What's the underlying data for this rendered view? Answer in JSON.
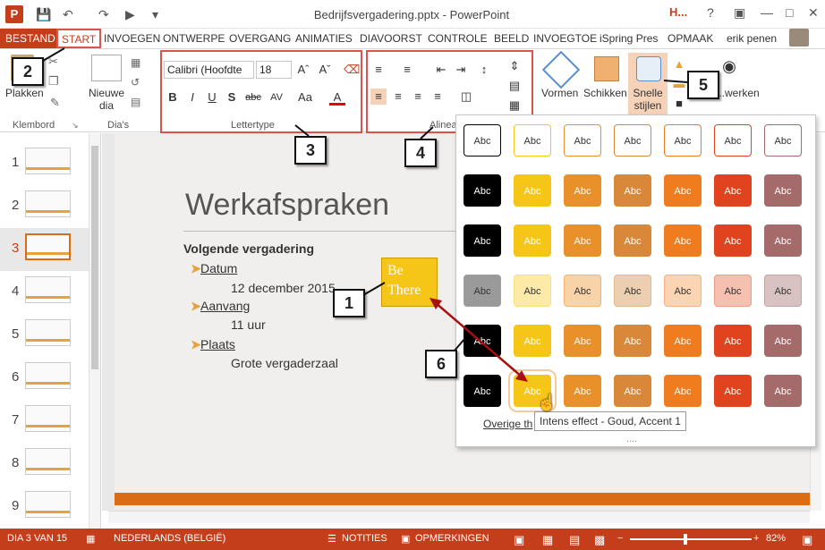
{
  "window": {
    "title": "Bedrijfsvergadering.pptx - PowerPoint",
    "user": "erik penen",
    "help": "?",
    "ppt_badge": "P"
  },
  "tabs": {
    "file": "BESTAND",
    "start": "START",
    "insert": "INVOEGEN",
    "design": "ONTWERPE",
    "transitions": "OVERGANG",
    "animations": "ANIMATIES",
    "slideshow": "DIAVOORST",
    "review": "CONTROLE",
    "view": "BEELD",
    "insert2": "INVOEGTOE",
    "ispring": "iSpring Pres",
    "format": "OPMAAK",
    "h": "H..."
  },
  "ribbon": {
    "paste": "Plakken",
    "new_slide": "Nieuwe dia",
    "clipboard_group": "Klembord",
    "slides_group": "Dia's",
    "font_name": "Calibri (Hoofdte",
    "font_size": "18",
    "font_group": "Lettertype",
    "paragraph_group": "Alinea",
    "shapes": "Vormen",
    "arrange": "Schikken",
    "quick_styles": "Snelle stijlen",
    "edit": "...werken",
    "bold": "B",
    "italic": "I",
    "underline": "U",
    "shadow": "S",
    "strike": "abc",
    "spacing": "AV",
    "case": "Aa",
    "font_color": "A"
  },
  "slides": {
    "current": 3,
    "numbers": [
      "1",
      "2",
      "3",
      "4",
      "5",
      "6",
      "7",
      "8",
      "9"
    ]
  },
  "slide": {
    "title": "Werkafspraken",
    "subtitle": "Volgende vergadering",
    "items": [
      {
        "label": "Datum",
        "value": "12 december 2015"
      },
      {
        "label": "Aanvang",
        "value": "11 uur"
      },
      {
        "label": "Plaats",
        "value": "Grote vergaderzaal"
      }
    ],
    "box_text": "Be There"
  },
  "gallery": {
    "swatch_label": "Abc",
    "more": "Overige th",
    "tooltip": "Intens effect - Goud, Accent 1",
    "grip": "....",
    "colors": [
      "#000000",
      "#f5c518",
      "#e8912a",
      "#d9883a",
      "#ef7d1f",
      "#e2431f",
      "#a56a6a"
    ]
  },
  "callouts": [
    "1",
    "2",
    "3",
    "4",
    "5",
    "6"
  ],
  "status": {
    "slide": "DIA 3 VAN 15",
    "language": "NEDERLANDS (BELGIË)",
    "notes": "NOTITIES",
    "comments": "OPMERKINGEN",
    "zoom": "82%"
  }
}
